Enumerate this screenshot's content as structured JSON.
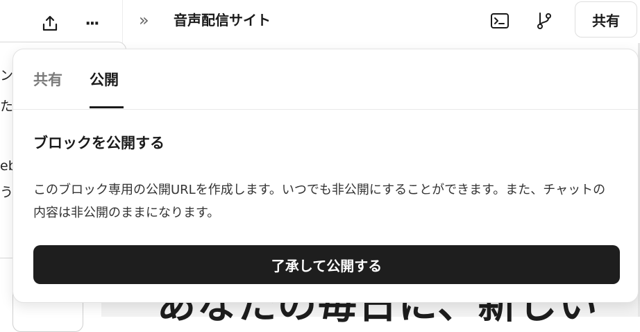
{
  "topbar": {
    "upload_icon": "upload-icon",
    "more_icon": "more-icon",
    "more_label": "···",
    "expand_label": "»",
    "title": "音声配信サイト",
    "terminal_icon": "terminal-icon",
    "branch_icon": "branch-icon",
    "share_label": "共有"
  },
  "background": {
    "fragments": [
      "ン",
      "たい",
      "eb",
      "うた"
    ],
    "heading": "あなたの毎日に、新しい"
  },
  "popover": {
    "tabs": [
      {
        "label": "共有",
        "active": false
      },
      {
        "label": "公開",
        "active": true
      }
    ],
    "heading": "ブロックを公開する",
    "description": "このブロック専用の公開URLを作成します。いつでも非公開にすることができます。また、チャットの内容は非公開のままになります。",
    "button_label": "了承して公開する"
  }
}
